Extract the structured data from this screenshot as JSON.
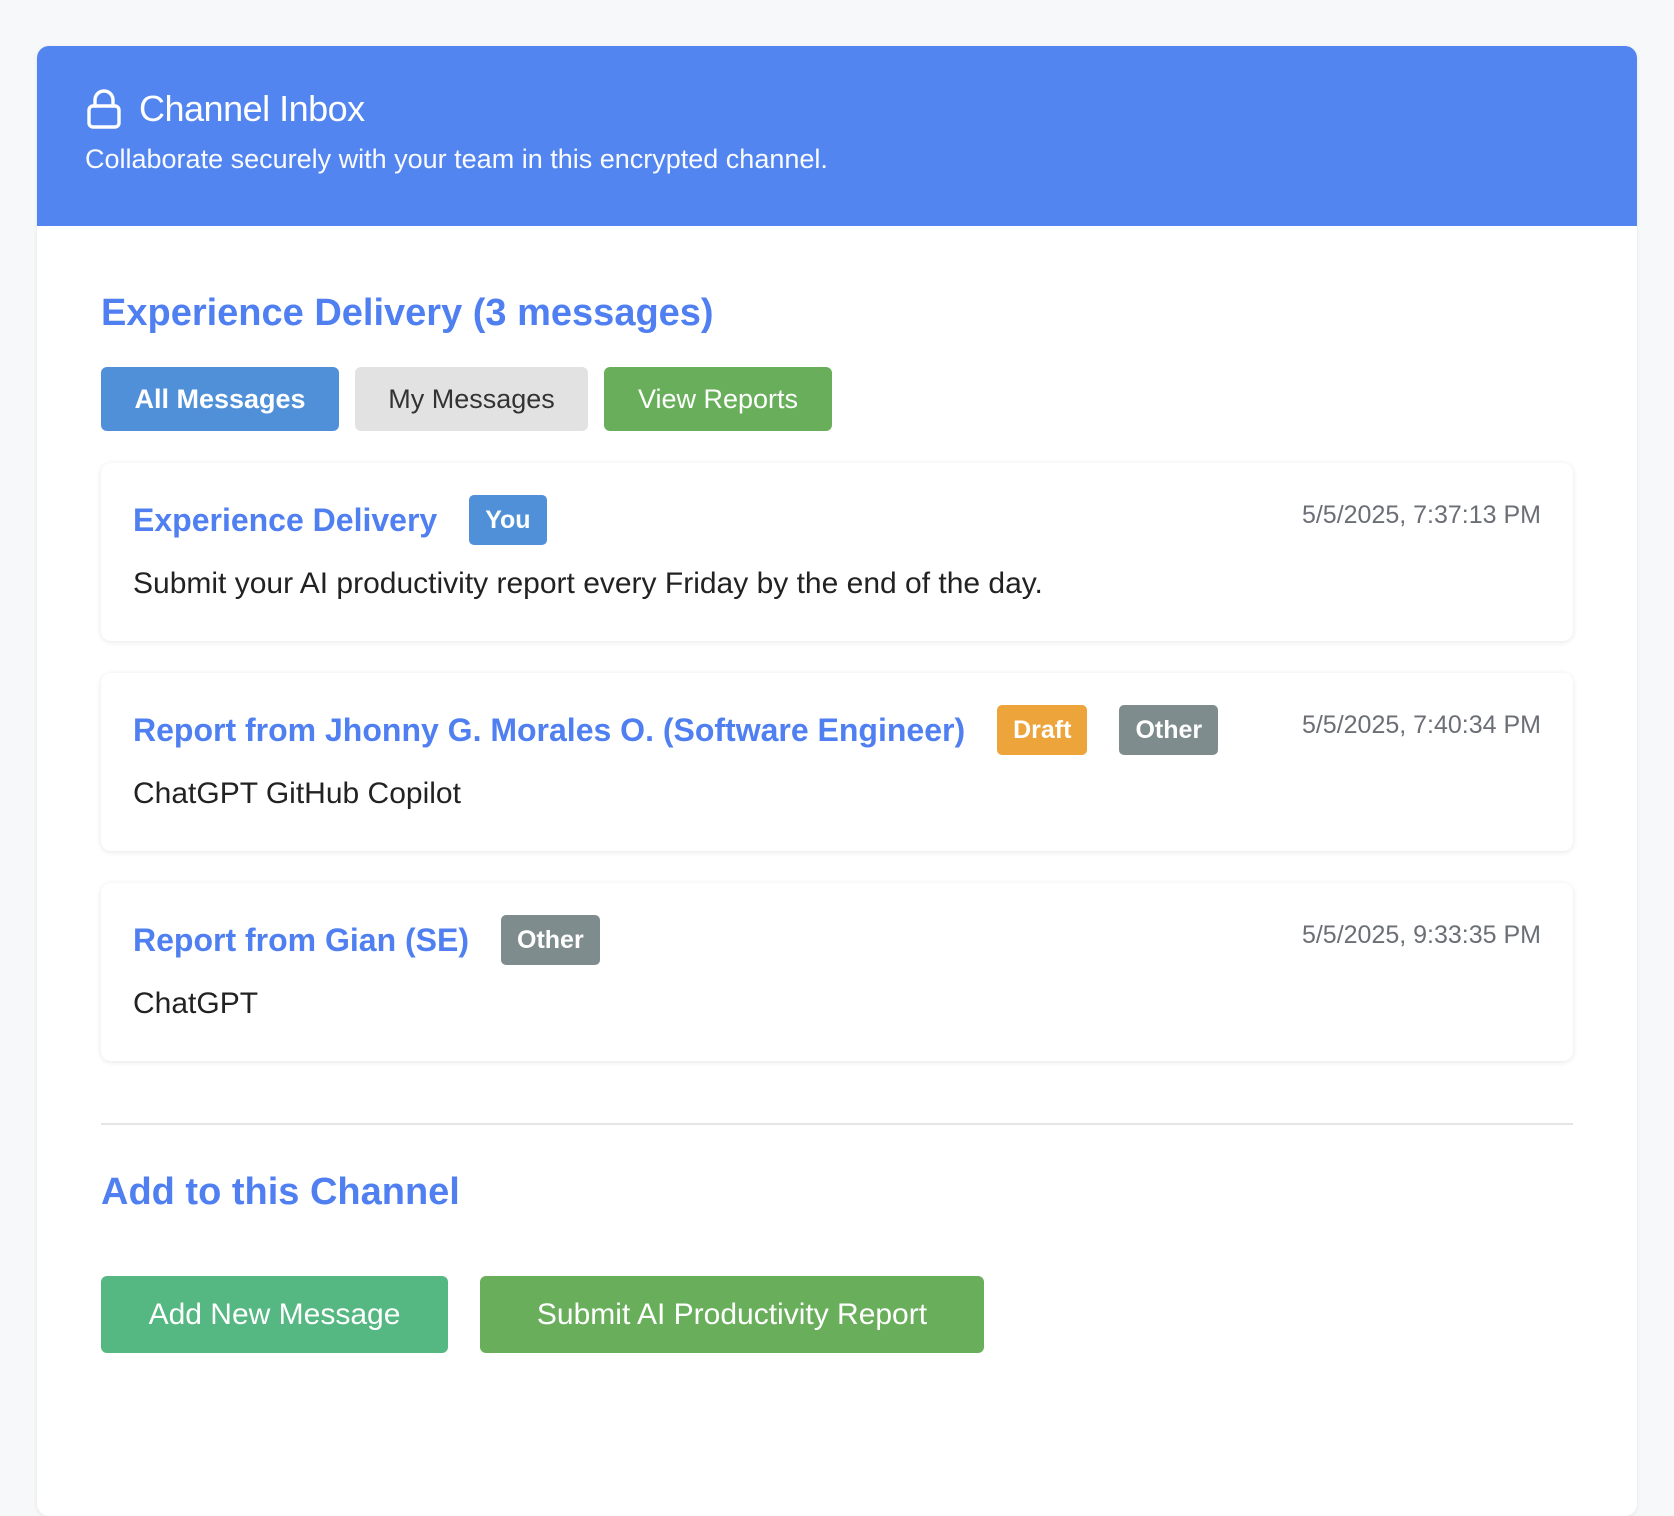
{
  "header": {
    "title": "Channel Inbox",
    "subtitle": "Collaborate securely with your team in this encrypted channel."
  },
  "channel": {
    "title": "Experience Delivery (3 messages)"
  },
  "filters": {
    "all": "All Messages",
    "mine": "My Messages",
    "reports": "View Reports"
  },
  "messages": [
    {
      "title": "Experience Delivery",
      "badges": [
        "You"
      ],
      "time": "5/5/2025, 7:37:13 PM",
      "body": "Submit your AI productivity report every Friday by the end of the day."
    },
    {
      "title": "Report from Jhonny G. Morales O. (Software Engineer)",
      "badges": [
        "Draft",
        "Other"
      ],
      "time": "5/5/2025, 7:40:34 PM",
      "body": "ChatGPT GitHub Copilot"
    },
    {
      "title": "Report from Gian (SE)",
      "badges": [
        "Other"
      ],
      "time": "5/5/2025, 9:33:35 PM",
      "body": "ChatGPT"
    }
  ],
  "add_section": {
    "title": "Add to this Channel",
    "add_button": "Add New Message",
    "submit_button": "Submit AI Productivity Report"
  },
  "colors": {
    "header_bg": "#5285ef",
    "accent_text": "#4f7ff0",
    "badge_you": "#4f90d9",
    "badge_draft": "#eca43b",
    "badge_other": "#7f8c8d",
    "green": "#69af5b",
    "green_alt": "#55b781"
  },
  "icons": {
    "header": "lock-icon"
  }
}
